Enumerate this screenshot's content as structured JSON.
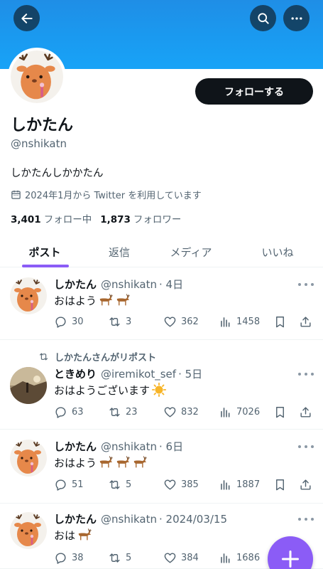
{
  "header": {
    "back_icon": "arrow-left-icon",
    "search_icon": "search-icon",
    "more_icon": "more-horizontal-icon"
  },
  "profile": {
    "display_name": "しかたん",
    "handle": "@nshikatn",
    "bio": "しかたんしかかたん",
    "joined": "2024年1月から Twitter を利用しています",
    "following_count": "3,401",
    "following_label": "フォロー中",
    "followers_count": "1,873",
    "followers_label": "フォロワー",
    "follow_button": "フォローする"
  },
  "tabs": [
    {
      "label": "ポスト",
      "active": true
    },
    {
      "label": "返信",
      "active": false
    },
    {
      "label": "メディア",
      "active": false
    },
    {
      "label": "いいね",
      "active": false
    }
  ],
  "posts": [
    {
      "name": "しかたん",
      "handle": "@nshikatn",
      "time": "· 4日",
      "text": "おはよう",
      "emoji": [
        "deer",
        "deer"
      ],
      "replies": "30",
      "reposts": "3",
      "likes": "362",
      "views": "1458"
    },
    {
      "repost_label": "しかたんさんがリポスト",
      "name": "ときめり",
      "handle": "@iremikot_sef",
      "time": "· 5日",
      "text": "おはようございます",
      "emoji": [
        "sun"
      ],
      "replies": "63",
      "reposts": "23",
      "likes": "832",
      "views": "7026"
    },
    {
      "name": "しかたん",
      "handle": "@nshikatn",
      "time": "· 6日",
      "text": "おはよう",
      "emoji": [
        "deer",
        "deer",
        "deer"
      ],
      "replies": "51",
      "reposts": "5",
      "likes": "385",
      "views": "1887"
    },
    {
      "name": "しかたん",
      "handle": "@nshikatn",
      "time": "· 2024/03/15",
      "text": "おは",
      "emoji": [
        "deer"
      ],
      "replies": "38",
      "reposts": "5",
      "likes": "384",
      "views": "1686"
    }
  ],
  "fab": {
    "icon": "plus-icon"
  },
  "colors": {
    "banner": "#1a9af0",
    "accent": "#8b5cf6",
    "text": "#0f1419",
    "muted": "#536471"
  }
}
